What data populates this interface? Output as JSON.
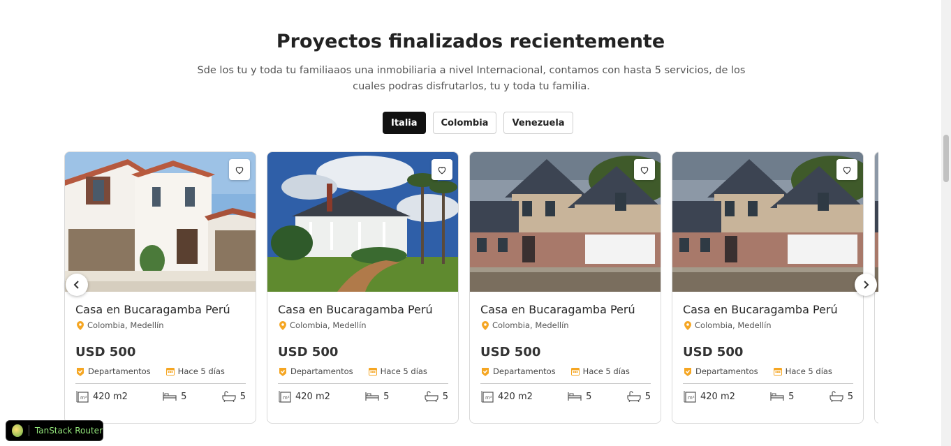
{
  "section": {
    "title": "Proyectos finalizados recientemente",
    "subtitle": "Sde los tu y toda tu familiaaos una inmobiliaria a nivel Internacional, contamos con hasta 5 servicios, de los cuales podras disfrutarlos, tu y toda tu familia."
  },
  "tabs": [
    {
      "label": "Italia",
      "active": true
    },
    {
      "label": "Colombia",
      "active": false
    },
    {
      "label": "Venezuela",
      "active": false
    }
  ],
  "cards": [
    {
      "name": "Casa en Bucaragamba Perú",
      "location": "Colombia, Medellín",
      "price": "USD 500",
      "type": "Departamentos",
      "time": "Hace 5 días",
      "area": "420 m2",
      "beds": "5",
      "baths": "5",
      "image": "white-villa"
    },
    {
      "name": "Casa en Bucaragamba Perú",
      "location": "Colombia, Medellín",
      "price": "USD 500",
      "type": "Departamentos",
      "time": "Hace 5 días",
      "area": "420 m2",
      "beds": "5",
      "baths": "5",
      "image": "victorian-mansion"
    },
    {
      "name": "Casa en Bucaragamba Perú",
      "location": "Colombia, Medellín",
      "price": "USD 500",
      "type": "Departamentos",
      "time": "Hace 5 días",
      "area": "420 m2",
      "beds": "5",
      "baths": "5",
      "image": "suburban-house"
    },
    {
      "name": "Casa en Bucaragamba Perú",
      "location": "Colombia, Medellín",
      "price": "USD 500",
      "type": "Departamentos",
      "time": "Hace 5 días",
      "area": "420 m2",
      "beds": "5",
      "baths": "5",
      "image": "suburban-house"
    }
  ],
  "devtools": {
    "label": "TanStack Router"
  },
  "colors": {
    "accent_orange": "#f5a623",
    "active_tab": "#111111"
  },
  "icons": [
    "heart-icon",
    "location-pin-icon",
    "check-badge-icon",
    "calendar-icon",
    "area-icon",
    "bed-icon",
    "bath-icon",
    "chevron-left-icon",
    "chevron-right-icon"
  ]
}
